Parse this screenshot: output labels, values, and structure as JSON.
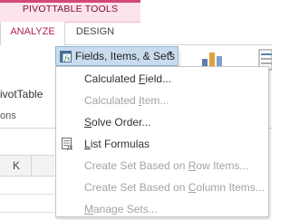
{
  "ribbon": {
    "context_group_label": "PIVOTTABLE TOOLS",
    "tabs": [
      {
        "label": "ANALYZE",
        "active": true
      },
      {
        "label": "DESIGN",
        "active": false
      }
    ],
    "truncated_left_text_1": "ivotTable",
    "truncated_left_text_2": "ons"
  },
  "split_button": {
    "label": "Fields, Items, & Sets",
    "icon": "fields-items-sets-icon",
    "dropdown_arrow": "▾"
  },
  "menu": {
    "items": [
      {
        "before": "Calculated ",
        "key": "F",
        "after": "ield...",
        "enabled": true,
        "icon": null
      },
      {
        "before": "Calculated ",
        "key": "I",
        "after": "tem...",
        "enabled": false,
        "icon": null
      },
      {
        "before": "",
        "key": "S",
        "after": "olve Order...",
        "enabled": true,
        "icon": null
      },
      {
        "before": "",
        "key": "L",
        "after": "ist Formulas",
        "enabled": true,
        "icon": "list-formulas-icon"
      },
      {
        "before": "Create Set Based on ",
        "key": "R",
        "after": "ow Items...",
        "enabled": false,
        "icon": null
      },
      {
        "before": "Create Set Based on ",
        "key": "C",
        "after": "olumn Items...",
        "enabled": false,
        "icon": null
      },
      {
        "before": "",
        "key": "M",
        "after": "anage Sets...",
        "enabled": false,
        "icon": null
      }
    ]
  },
  "sheet": {
    "column_header": "K"
  },
  "colors": {
    "context_pink": "#fde3ec",
    "context_accent": "#d24978",
    "active_tab_text": "#b5224f",
    "button_hover": "#c9dcef",
    "button_border": "#8eb0d6",
    "disabled_text": "#a3a3a3"
  }
}
